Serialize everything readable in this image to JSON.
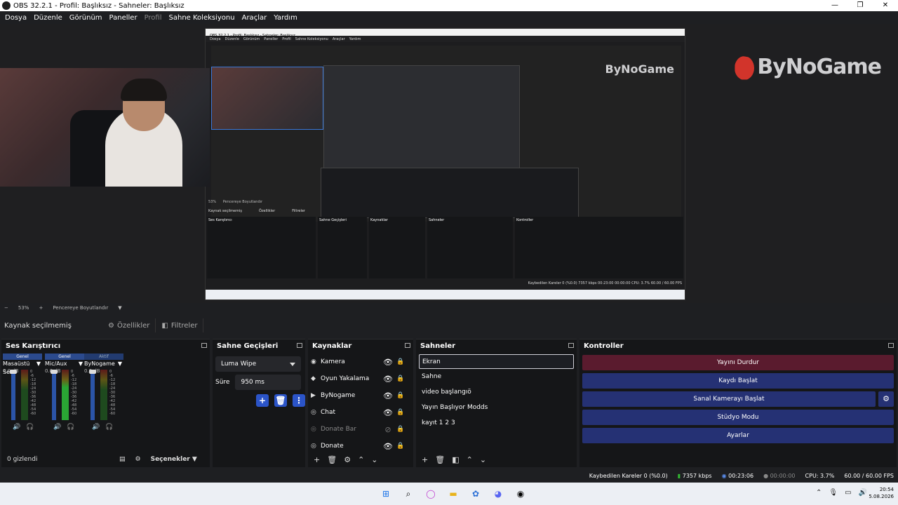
{
  "window": {
    "title": "OBS 32.2.1 - Profil: Başlıksız - Sahneler: Başlıksız",
    "min": "—",
    "max": "❐",
    "close": "✕"
  },
  "menu": [
    "Dosya",
    "Düzenle",
    "Görünüm",
    "Paneller",
    "Profil",
    "Sahne Koleksiyonu",
    "Araçlar",
    "Yardım"
  ],
  "nested": {
    "title": "OBS 32.2.1 - Profil: Başlıksız - Sahneler: Başlıksız",
    "menu": [
      "Dosya",
      "Düzenle",
      "Görünüm",
      "Paneller",
      "Profil",
      "Sahne Koleksiyonu",
      "Araçlar",
      "Yardım"
    ],
    "zoom": "53%",
    "resize": "Pencereye Boyutlandır",
    "none_selected": "Kaynak seçilmemiş",
    "props": "Özellikler",
    "filters": "Filtreler",
    "docks": [
      "Ses Karıştırıcı",
      "Sahne Geçişleri",
      "Kaynaklar",
      "Sahneler",
      "Kontroller"
    ],
    "status": "Kaybedilen Kareler 0 (%0.0)   7357 kbps   00:23:00   00:00:00   CPU: 3.7%   60.00 / 60.00 FPS"
  },
  "logo": "ByNoGame",
  "zoom": {
    "minus": "−",
    "value": "53%",
    "plus": "+",
    "fit": "Pencereye Boyutlandır"
  },
  "context": {
    "none_selected": "Kaynak seçilmemiş",
    "properties": "Özellikler",
    "filters": "Filtreler"
  },
  "mixer": {
    "title": "Ses Karıştırıcı",
    "channels": [
      {
        "tag": "Genel",
        "name": "Masaüstü Ses",
        "db": "0.0 dB"
      },
      {
        "tag": "Genel",
        "name": "Mic/Aux",
        "db": "0.0 dB"
      },
      {
        "tag": "Aktif",
        "name": "ByNogame",
        "db": "0.0 dB"
      }
    ],
    "scale": [
      "0",
      "-6",
      "-12",
      "-18",
      "-24",
      "-30",
      "-36",
      "-42",
      "-48",
      "-54",
      "-60"
    ],
    "hidden": "0 gizlendi",
    "options": "Seçenekler"
  },
  "transitions": {
    "title": "Sahne Geçişleri",
    "selected": "Luma Wipe",
    "duration_label": "Süre",
    "duration": "950 ms"
  },
  "sources": {
    "title": "Kaynaklar",
    "items": [
      {
        "name": "Kamera",
        "icon": "📷",
        "dim": false
      },
      {
        "name": "Oyun Yakalama",
        "icon": "🎮",
        "dim": false
      },
      {
        "name": "ByNogame",
        "icon": "▶",
        "dim": false
      },
      {
        "name": "Chat",
        "icon": "🌐",
        "dim": false
      },
      {
        "name": "Donate Bar",
        "icon": "🌐",
        "dim": true
      },
      {
        "name": "Donate",
        "icon": "🌐",
        "dim": false
      }
    ]
  },
  "scenes": {
    "title": "Sahneler",
    "items": [
      "Ekran",
      "Sahne",
      "video başlangıö",
      "Yayın Başlıyor Modds",
      "kayıt 1 2 3"
    ]
  },
  "controls": {
    "title": "Kontroller",
    "stop_stream": "Yayını Durdur",
    "start_record": "Kaydı Başlat",
    "virtual_cam": "Sanal Kamerayı Başlat",
    "studio": "Stüdyo Modu",
    "settings": "Ayarlar"
  },
  "status": {
    "dropped": "Kaybedilen Kareler 0 (%0.0)",
    "bitrate": "7357 kbps",
    "stream_time": "00:23:06",
    "rec_time": "00:00:00",
    "cpu": "CPU: 3.7%",
    "fps": "60.00 / 60.00 FPS"
  },
  "clock": {
    "time": "20:54",
    "date": "5.08.2026"
  },
  "colors": {
    "accent": "#2b54c8",
    "stop": "#5a1b2e",
    "control": "#253174",
    "green": "#2aa534"
  }
}
